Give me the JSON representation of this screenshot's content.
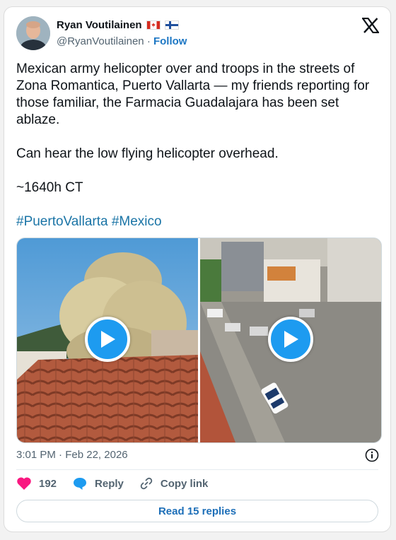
{
  "author": {
    "name": "Ryan Voutilainen",
    "flags": [
      "canada-flag-icon",
      "finland-flag-icon"
    ],
    "handle": "@RyanVoutilainen",
    "separator": "·",
    "follow_label": "Follow"
  },
  "tweet": {
    "paragraphs": [
      "Mexican army helicopter over and troops in the streets of Zona Romantica, Puerto Vallarta — my friends reporting for those familiar, the Farmacia Guadalajara has been set ablaze.",
      "Can hear the low flying helicopter overhead.",
      "~1640h CT"
    ],
    "hashtags": [
      "#PuertoVallarta",
      "#Mexico"
    ]
  },
  "media": [
    {
      "icon": "play-icon"
    },
    {
      "icon": "play-icon"
    }
  ],
  "meta": {
    "time": "3:01 PM",
    "separator": "·",
    "date": "Feb 22, 2026"
  },
  "actions": {
    "like_count": "192",
    "reply_label": "Reply",
    "copy_link_label": "Copy link"
  },
  "read_replies_label": "Read 15 replies",
  "colors": {
    "link": "#1a74a6",
    "accent": "#1d9bf0",
    "heart": "#f91880"
  }
}
